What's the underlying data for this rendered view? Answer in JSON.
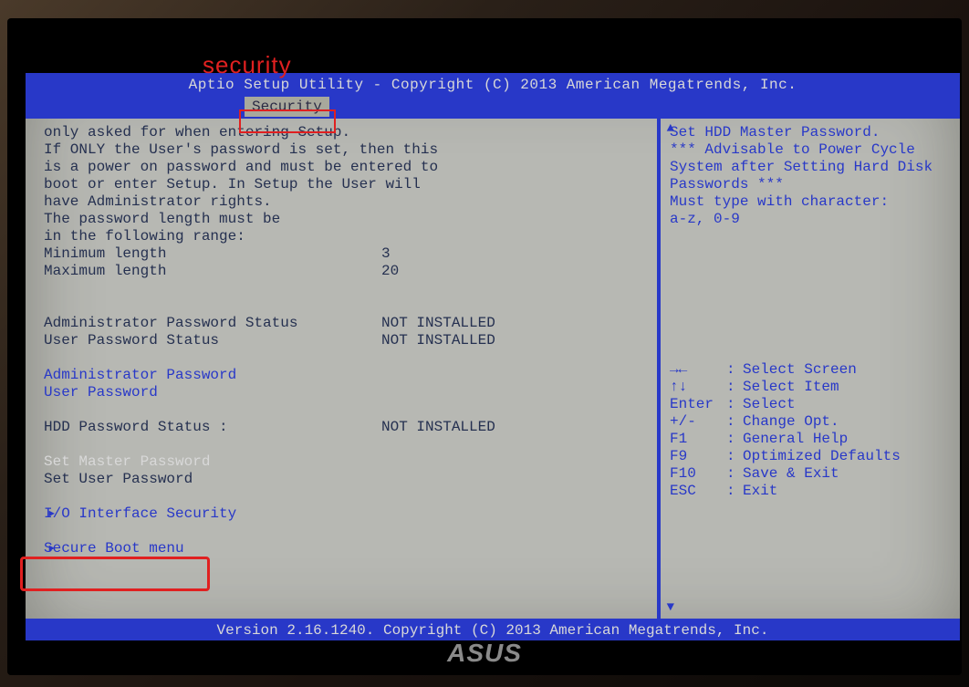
{
  "annotation": {
    "label": "security"
  },
  "header": {
    "title": "Aptio Setup Utility - Copyright (C) 2013 American Megatrends, Inc.",
    "active_tab": "Security"
  },
  "left": {
    "intro": {
      "l1": "only asked for when entering Setup.",
      "l2": "If ONLY the User's password is set, then this",
      "l3": "is a power on password and must be entered to",
      "l4": "boot or enter Setup. In Setup the User will",
      "l5": "have Administrator rights.",
      "l6": "The password length must be",
      "l7": "in the following range:"
    },
    "min_length": {
      "label": "Minimum length",
      "value": "3"
    },
    "max_length": {
      "label": "Maximum length",
      "value": "20"
    },
    "admin_status": {
      "label": "Administrator Password Status",
      "value": "NOT INSTALLED"
    },
    "user_status": {
      "label": "User Password Status",
      "value": "NOT INSTALLED"
    },
    "admin_pw": "Administrator Password",
    "user_pw": "User Password",
    "hdd_status": {
      "label": "HDD Password Status  :",
      "value": "NOT INSTALLED"
    },
    "set_master": "Set Master Password",
    "set_user": "Set User Password",
    "io_security": "I/O Interface Security",
    "secure_boot": "Secure Boot menu"
  },
  "right": {
    "help": {
      "l1": "Set HDD Master Password.",
      "l2": "*** Advisable to Power Cycle",
      "l3": "System after Setting Hard Disk",
      "l4": "Passwords ***",
      "l5": "Must type with character:",
      "l6": "a-z, 0-9"
    },
    "legend": {
      "i1": {
        "key": "→←",
        "text": "Select Screen"
      },
      "i2": {
        "key": "↑↓",
        "text": "Select Item"
      },
      "i3": {
        "key": "Enter",
        "text": "Select"
      },
      "i4": {
        "key": "+/-",
        "text": "Change Opt."
      },
      "i5": {
        "key": "F1",
        "text": "General Help"
      },
      "i6": {
        "key": "F9",
        "text": "Optimized Defaults"
      },
      "i7": {
        "key": "F10",
        "text": "Save & Exit"
      },
      "i8": {
        "key": "ESC",
        "text": "Exit"
      }
    }
  },
  "footer": {
    "version": "Version 2.16.1240. Copyright (C) 2013 American Megatrends, Inc."
  },
  "vendor": {
    "logo": "ASUS"
  }
}
